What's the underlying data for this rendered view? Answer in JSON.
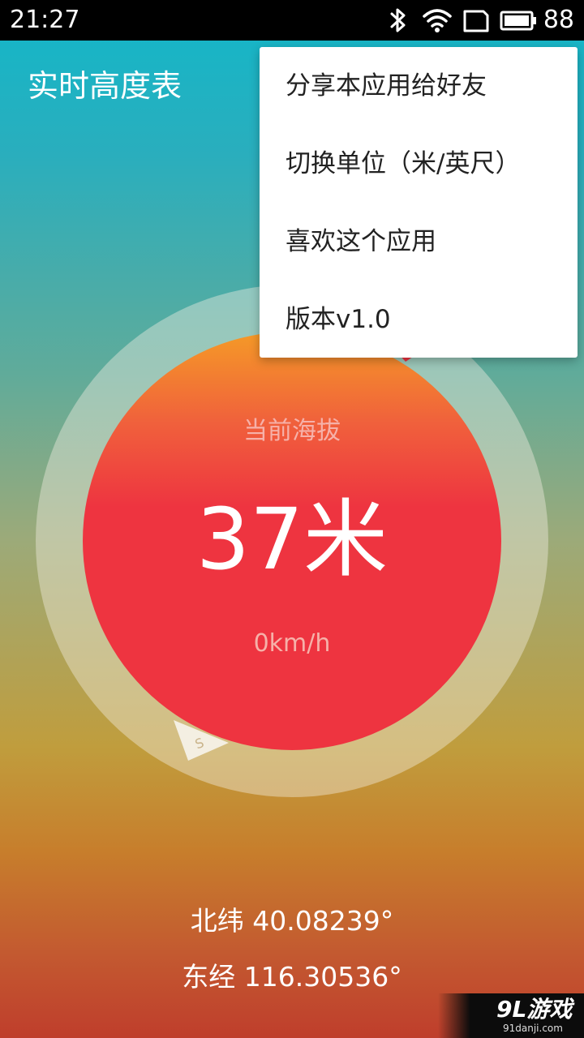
{
  "status_bar": {
    "time": "21:27",
    "battery_percent": "88",
    "icons": [
      "bluetooth-icon",
      "wifi-icon",
      "screen-rotate-icon",
      "battery-icon"
    ]
  },
  "app": {
    "title": "实时高度表"
  },
  "gauge": {
    "label": "当前海拔",
    "altitude": "37米",
    "speed": "0km/h",
    "compass_south": "S",
    "colors": {
      "inner_top": "#f59a27",
      "inner_main": "#ee3440",
      "ring": "#f3efe3"
    }
  },
  "location": {
    "latitude": "北纬 40.08239°",
    "longitude": "东经 116.30536°"
  },
  "menu": {
    "items": [
      {
        "label": "分享本应用给好友"
      },
      {
        "label": "切换单位（米/英尺）"
      },
      {
        "label": "喜欢这个应用"
      },
      {
        "label": "版本v1.0"
      }
    ]
  },
  "watermark": {
    "logo": "9L游戏",
    "url": "91danji.com"
  }
}
